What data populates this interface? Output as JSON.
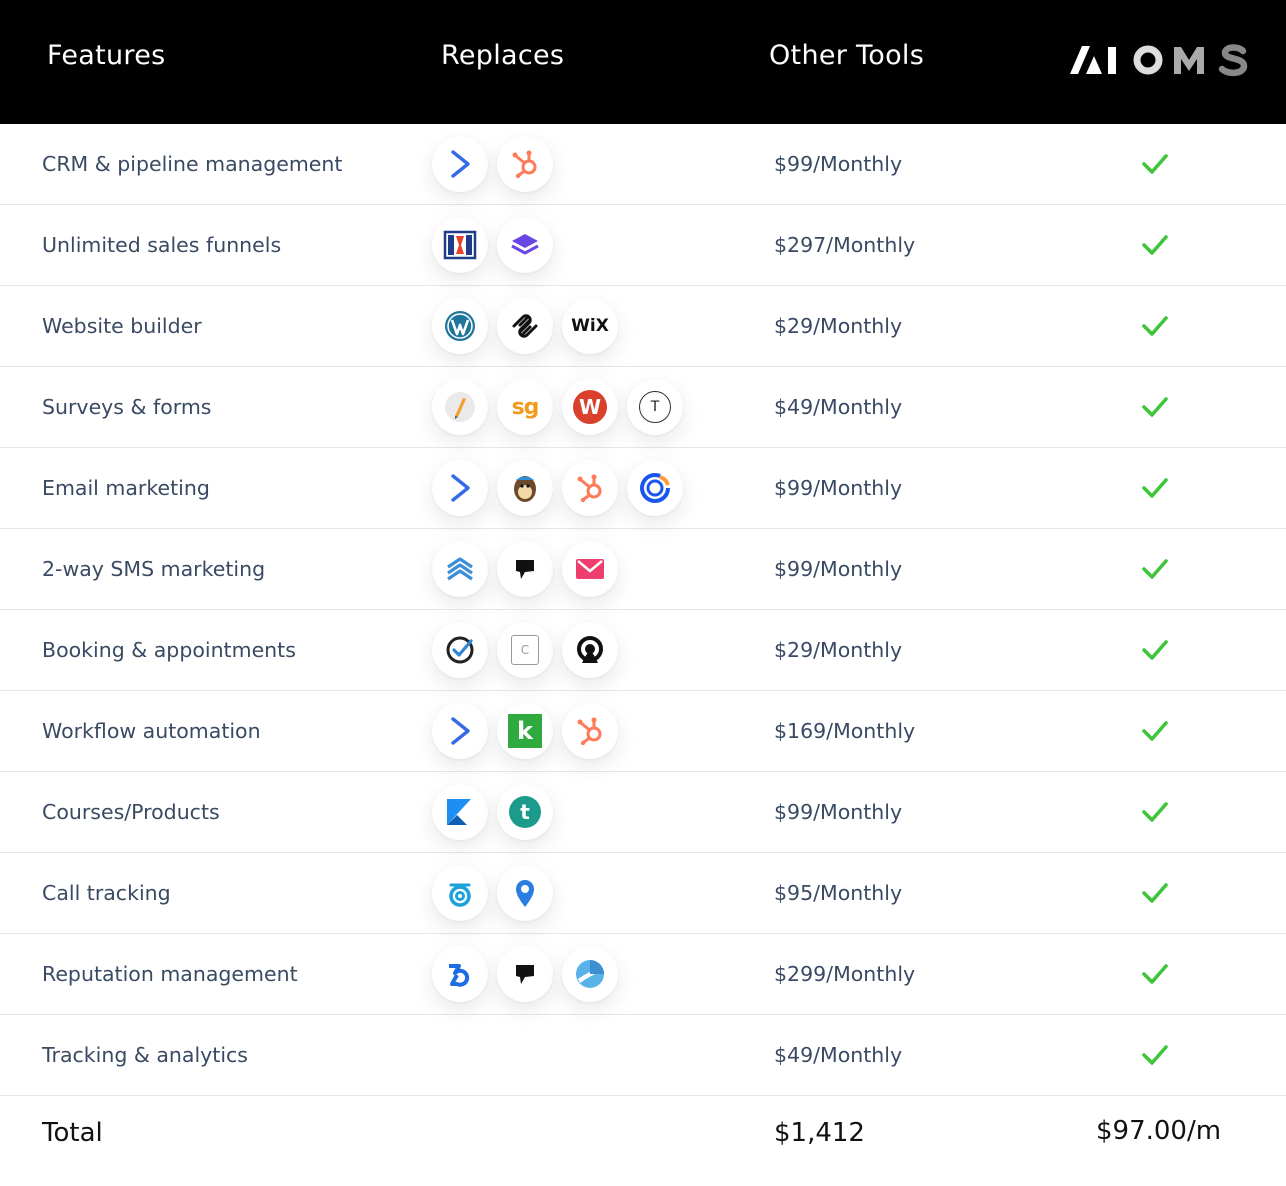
{
  "header": {
    "features_label": "Features",
    "replaces_label": "Replaces",
    "other_tools_label": "Other Tools",
    "brand": "AIOMS"
  },
  "rows": [
    {
      "feature": "CRM & pipeline management",
      "price": "$99/Monthly",
      "icons": [
        "activecampaign-icon",
        "hubspot-icon"
      ]
    },
    {
      "feature": "Unlimited sales funnels",
      "price": "$297/Monthly",
      "icons": [
        "clickfunnels-icon",
        "leadpages-icon"
      ]
    },
    {
      "feature": "Website builder",
      "price": "$29/Monthly",
      "icons": [
        "wordpress-icon",
        "squarespace-icon",
        "wix-icon"
      ],
      "icon_text": {
        "wix": "WiX"
      }
    },
    {
      "feature": "Surveys & forms",
      "price": "$49/Monthly",
      "icons": [
        "jotform-icon",
        "surveygizmo-icon",
        "wufoo-icon",
        "typeform-icon"
      ],
      "icon_text": {
        "surveygizmo": "sg",
        "wufoo": "W",
        "typeform": "T"
      }
    },
    {
      "feature": "Email marketing",
      "price": "$99/Monthly",
      "icons": [
        "activecampaign-icon",
        "mailchimp-icon",
        "hubspot-icon",
        "constantcontact-icon"
      ]
    },
    {
      "feature": "2-way SMS marketing",
      "price": "$99/Monthly",
      "icons": [
        "textmagic-icon",
        "podium-icon",
        "simpletexting-icon"
      ]
    },
    {
      "feature": "Booking & appointments",
      "price": "$29/Monthly",
      "icons": [
        "acuity-icon",
        "calendly-icon",
        "appointlet-icon"
      ],
      "icon_text": {
        "calendly": "C"
      }
    },
    {
      "feature": "Workflow automation",
      "price": "$169/Monthly",
      "icons": [
        "activecampaign-icon",
        "keap-icon",
        "hubspot-icon"
      ],
      "icon_text": {
        "keap": "k"
      }
    },
    {
      "feature": "Courses/Products",
      "price": "$99/Monthly",
      "icons": [
        "kajabi-icon",
        "teachable-icon"
      ],
      "icon_text": {
        "teachable": "t"
      }
    },
    {
      "feature": "Call tracking",
      "price": "$95/Monthly",
      "icons": [
        "callrail-icon",
        "calltrackingmetrics-icon"
      ]
    },
    {
      "feature": "Reputation management",
      "price": "$299/Monthly",
      "icons": [
        "birdeye-icon",
        "podium-icon",
        "yext-icon"
      ]
    },
    {
      "feature": "Tracking & analytics",
      "price": "$49/Monthly",
      "icons": []
    }
  ],
  "total": {
    "label": "Total",
    "other_tools": "$1,412",
    "aioms": "$97.00/m"
  },
  "colors": {
    "header_bg": "#000000",
    "check": "#3fc53a",
    "text": "#3a4a63",
    "divider": "#e6e7ea"
  }
}
